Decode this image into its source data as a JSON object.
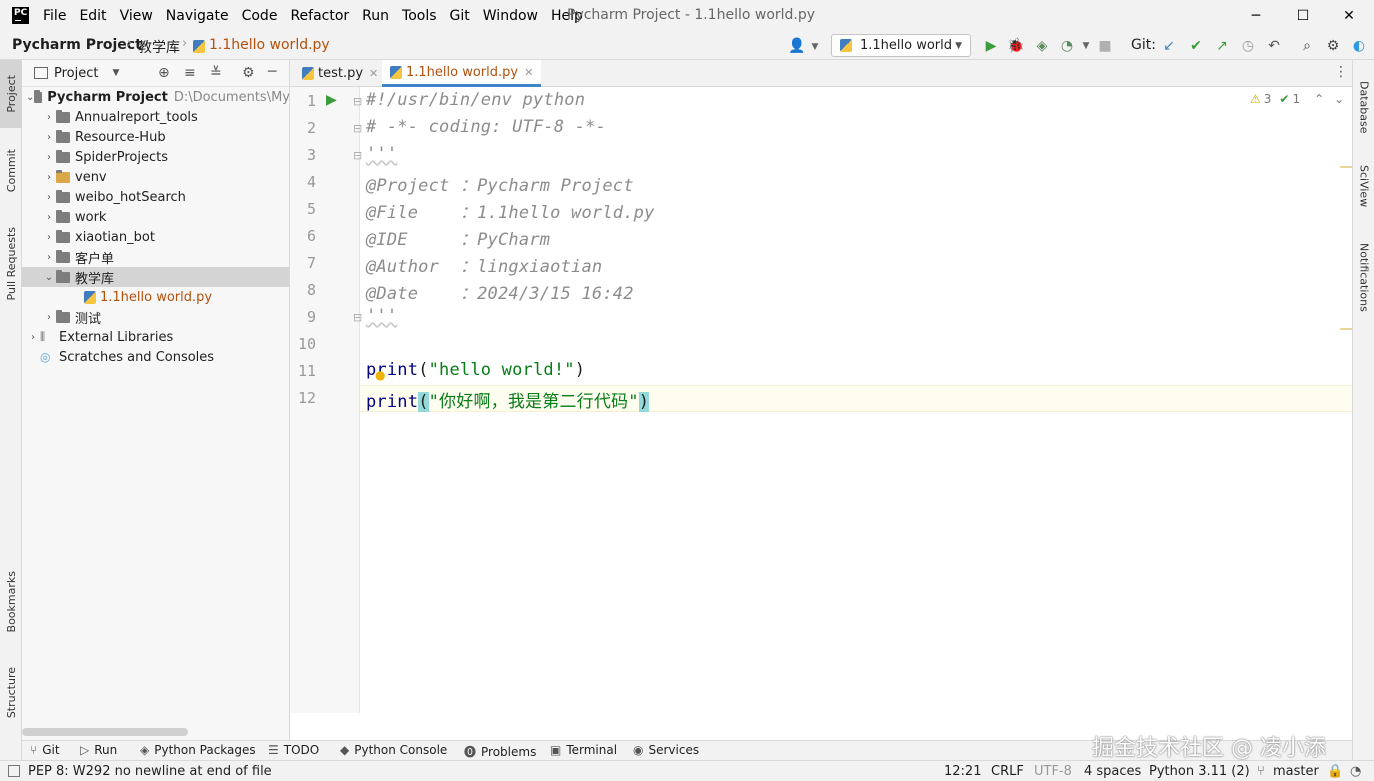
{
  "menu": [
    "File",
    "Edit",
    "View",
    "Navigate",
    "Code",
    "Refactor",
    "Run",
    "Tools",
    "Git",
    "Window",
    "Help"
  ],
  "window_title": "Pycharm Project - 1.1hello world.py",
  "breadcrumb": {
    "project": "Pycharm Project",
    "folder": "教学库",
    "file": "1.1hello world.py"
  },
  "run_config": "1.1hello world",
  "git_label": "Git:",
  "left_tabs": {
    "project": "Project",
    "commit": "Commit",
    "pull_requests": "Pull Requests",
    "bookmarks": "Bookmarks",
    "structure": "Structure"
  },
  "right_tabs": {
    "database": "Database",
    "sciview": "SciView",
    "notifications": "Notifications"
  },
  "project_panel": {
    "title": "Project",
    "root": {
      "name": "Pycharm Project",
      "path": "D:\\Documents\\My"
    },
    "items": [
      {
        "label": "Annualreport_tools"
      },
      {
        "label": "Resource-Hub"
      },
      {
        "label": "SpiderProjects"
      },
      {
        "label": "venv"
      },
      {
        "label": "weibo_hotSearch"
      },
      {
        "label": "work"
      },
      {
        "label": "xiaotian_bot"
      },
      {
        "label": "客户单"
      },
      {
        "label": "教学库"
      },
      {
        "label": "1.1hello world.py"
      },
      {
        "label": "测试"
      }
    ],
    "external_libraries": "External Libraries",
    "scratches": "Scratches and Consoles"
  },
  "editor_tabs": [
    {
      "label": "test.py"
    },
    {
      "label": "1.1hello world.py"
    }
  ],
  "inspections": {
    "warnings": "3",
    "weak_warnings": "1"
  },
  "code_lines": [
    {
      "num": "1",
      "text": "#!/usr/bin/env python"
    },
    {
      "num": "2",
      "text": "# -*- coding: UTF-8 -*-"
    },
    {
      "num": "3",
      "text": "'''"
    },
    {
      "num": "4",
      "text": "@Project ：Pycharm Project"
    },
    {
      "num": "5",
      "text": "@File    ：1.1hello world.py"
    },
    {
      "num": "6",
      "text": "@IDE     ：PyCharm"
    },
    {
      "num": "7",
      "text": "@Author  ：lingxiaotian"
    },
    {
      "num": "8",
      "text": "@Date    ：2024/3/15 16:42"
    },
    {
      "num": "9",
      "text": "'''"
    },
    {
      "num": "10",
      "text": ""
    },
    {
      "num": "11",
      "kw": "print",
      "open": "(",
      "str": "\"hello world!\"",
      "close": ")"
    },
    {
      "num": "12",
      "kw": "print",
      "open": "(",
      "str": "\"你好啊，我是第二行代码\"",
      "close": ")"
    }
  ],
  "bottom_tools": [
    "Git",
    "Run",
    "Python Packages",
    "TODO",
    "Python Console",
    "Problems",
    "Terminal",
    "Services"
  ],
  "status": {
    "message": "PEP 8: W292 no newline at end of file",
    "position": "12:21",
    "line_sep": "CRLF",
    "encoding": "UTF-8",
    "indent": "4 spaces",
    "interpreter": "Python 3.11 (2)",
    "branch": "master"
  },
  "watermark": "掘金技术社区 @ 凌小添"
}
